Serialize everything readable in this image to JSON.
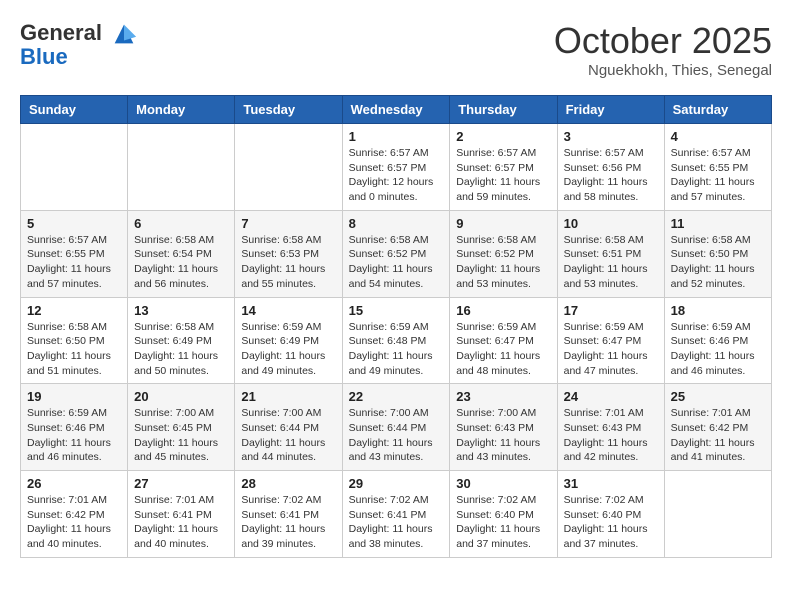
{
  "logo": {
    "line1": "General",
    "line2": "Blue"
  },
  "title": "October 2025",
  "location": "Nguekhokh, Thies, Senegal",
  "weekdays": [
    "Sunday",
    "Monday",
    "Tuesday",
    "Wednesday",
    "Thursday",
    "Friday",
    "Saturday"
  ],
  "weeks": [
    [
      {
        "day": "",
        "info": ""
      },
      {
        "day": "",
        "info": ""
      },
      {
        "day": "",
        "info": ""
      },
      {
        "day": "1",
        "info": "Sunrise: 6:57 AM\nSunset: 6:57 PM\nDaylight: 12 hours\nand 0 minutes."
      },
      {
        "day": "2",
        "info": "Sunrise: 6:57 AM\nSunset: 6:57 PM\nDaylight: 11 hours\nand 59 minutes."
      },
      {
        "day": "3",
        "info": "Sunrise: 6:57 AM\nSunset: 6:56 PM\nDaylight: 11 hours\nand 58 minutes."
      },
      {
        "day": "4",
        "info": "Sunrise: 6:57 AM\nSunset: 6:55 PM\nDaylight: 11 hours\nand 57 minutes."
      }
    ],
    [
      {
        "day": "5",
        "info": "Sunrise: 6:57 AM\nSunset: 6:55 PM\nDaylight: 11 hours\nand 57 minutes."
      },
      {
        "day": "6",
        "info": "Sunrise: 6:58 AM\nSunset: 6:54 PM\nDaylight: 11 hours\nand 56 minutes."
      },
      {
        "day": "7",
        "info": "Sunrise: 6:58 AM\nSunset: 6:53 PM\nDaylight: 11 hours\nand 55 minutes."
      },
      {
        "day": "8",
        "info": "Sunrise: 6:58 AM\nSunset: 6:52 PM\nDaylight: 11 hours\nand 54 minutes."
      },
      {
        "day": "9",
        "info": "Sunrise: 6:58 AM\nSunset: 6:52 PM\nDaylight: 11 hours\nand 53 minutes."
      },
      {
        "day": "10",
        "info": "Sunrise: 6:58 AM\nSunset: 6:51 PM\nDaylight: 11 hours\nand 53 minutes."
      },
      {
        "day": "11",
        "info": "Sunrise: 6:58 AM\nSunset: 6:50 PM\nDaylight: 11 hours\nand 52 minutes."
      }
    ],
    [
      {
        "day": "12",
        "info": "Sunrise: 6:58 AM\nSunset: 6:50 PM\nDaylight: 11 hours\nand 51 minutes."
      },
      {
        "day": "13",
        "info": "Sunrise: 6:58 AM\nSunset: 6:49 PM\nDaylight: 11 hours\nand 50 minutes."
      },
      {
        "day": "14",
        "info": "Sunrise: 6:59 AM\nSunset: 6:49 PM\nDaylight: 11 hours\nand 49 minutes."
      },
      {
        "day": "15",
        "info": "Sunrise: 6:59 AM\nSunset: 6:48 PM\nDaylight: 11 hours\nand 49 minutes."
      },
      {
        "day": "16",
        "info": "Sunrise: 6:59 AM\nSunset: 6:47 PM\nDaylight: 11 hours\nand 48 minutes."
      },
      {
        "day": "17",
        "info": "Sunrise: 6:59 AM\nSunset: 6:47 PM\nDaylight: 11 hours\nand 47 minutes."
      },
      {
        "day": "18",
        "info": "Sunrise: 6:59 AM\nSunset: 6:46 PM\nDaylight: 11 hours\nand 46 minutes."
      }
    ],
    [
      {
        "day": "19",
        "info": "Sunrise: 6:59 AM\nSunset: 6:46 PM\nDaylight: 11 hours\nand 46 minutes."
      },
      {
        "day": "20",
        "info": "Sunrise: 7:00 AM\nSunset: 6:45 PM\nDaylight: 11 hours\nand 45 minutes."
      },
      {
        "day": "21",
        "info": "Sunrise: 7:00 AM\nSunset: 6:44 PM\nDaylight: 11 hours\nand 44 minutes."
      },
      {
        "day": "22",
        "info": "Sunrise: 7:00 AM\nSunset: 6:44 PM\nDaylight: 11 hours\nand 43 minutes."
      },
      {
        "day": "23",
        "info": "Sunrise: 7:00 AM\nSunset: 6:43 PM\nDaylight: 11 hours\nand 43 minutes."
      },
      {
        "day": "24",
        "info": "Sunrise: 7:01 AM\nSunset: 6:43 PM\nDaylight: 11 hours\nand 42 minutes."
      },
      {
        "day": "25",
        "info": "Sunrise: 7:01 AM\nSunset: 6:42 PM\nDaylight: 11 hours\nand 41 minutes."
      }
    ],
    [
      {
        "day": "26",
        "info": "Sunrise: 7:01 AM\nSunset: 6:42 PM\nDaylight: 11 hours\nand 40 minutes."
      },
      {
        "day": "27",
        "info": "Sunrise: 7:01 AM\nSunset: 6:41 PM\nDaylight: 11 hours\nand 40 minutes."
      },
      {
        "day": "28",
        "info": "Sunrise: 7:02 AM\nSunset: 6:41 PM\nDaylight: 11 hours\nand 39 minutes."
      },
      {
        "day": "29",
        "info": "Sunrise: 7:02 AM\nSunset: 6:41 PM\nDaylight: 11 hours\nand 38 minutes."
      },
      {
        "day": "30",
        "info": "Sunrise: 7:02 AM\nSunset: 6:40 PM\nDaylight: 11 hours\nand 37 minutes."
      },
      {
        "day": "31",
        "info": "Sunrise: 7:02 AM\nSunset: 6:40 PM\nDaylight: 11 hours\nand 37 minutes."
      },
      {
        "day": "",
        "info": ""
      }
    ]
  ]
}
